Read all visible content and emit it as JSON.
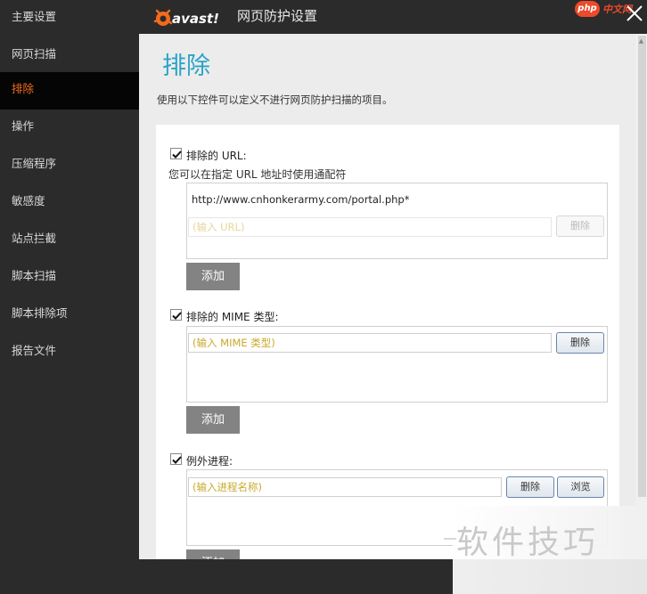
{
  "window": {
    "title": "网页防护设置",
    "logo_text": "avast!"
  },
  "watermark": {
    "php_badge": "php",
    "cn_text": "中文网",
    "bottom_text": "软件技巧"
  },
  "sidebar": {
    "items": [
      {
        "label": "主要设置"
      },
      {
        "label": "网页扫描"
      },
      {
        "label": "排除"
      },
      {
        "label": "操作"
      },
      {
        "label": "压缩程序"
      },
      {
        "label": "敏感度"
      },
      {
        "label": "站点拦截"
      },
      {
        "label": "脚本扫描"
      },
      {
        "label": "脚本排除项"
      },
      {
        "label": "报告文件"
      }
    ],
    "active_index": 2
  },
  "main": {
    "title": "排除",
    "description": "使用以下控件可以定义不进行网页防护扫描的项目。",
    "url_section": {
      "label": "排除的 URL:",
      "hint": "您可以在指定 URL 地址时使用通配符",
      "checked": true,
      "entries": [
        "http://www.cnhonkerarmy.com/portal.php*"
      ],
      "input_placeholder": "(输入 URL)",
      "delete_label": "删除",
      "add_label": "添加"
    },
    "mime_section": {
      "label": "排除的 MIME 类型:",
      "checked": true,
      "input_placeholder": "(输入 MIME 类型)",
      "delete_label": "删除",
      "add_label": "添加"
    },
    "process_section": {
      "label": "例外进程:",
      "checked": true,
      "input_placeholder": "(输入进程名称)",
      "delete_label": "删除",
      "browse_label": "浏览",
      "add_label": "添加"
    }
  },
  "colors": {
    "accent_orange": "#f26b1d",
    "title_blue": "#2aa3c7",
    "placeholder_gold": "#c9a92c"
  }
}
